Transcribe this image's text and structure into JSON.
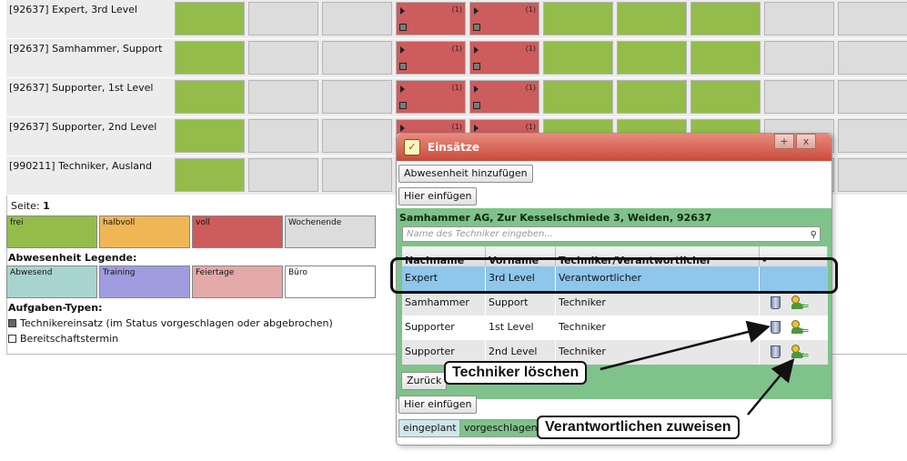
{
  "grid": {
    "rows": [
      {
        "name": "[92637] Expert, 3rd Level",
        "cells": [
          "green",
          "gray",
          "gray",
          "red",
          "red",
          "green",
          "green",
          "green",
          "gray",
          "gray"
        ]
      },
      {
        "name": "[92637] Samhammer, Support",
        "cells": [
          "green",
          "gray",
          "gray",
          "red",
          "red",
          "green",
          "green",
          "green",
          "gray",
          "gray"
        ]
      },
      {
        "name": "[92637] Supporter, 1st Level",
        "cells": [
          "green",
          "gray",
          "gray",
          "red",
          "red",
          "green",
          "green",
          "green",
          "gray",
          "gray"
        ]
      },
      {
        "name": "[92637] Supporter, 2nd Level",
        "cells": [
          "green",
          "gray",
          "gray",
          "red",
          "red",
          "green",
          "green",
          "green",
          "gray",
          "gray"
        ]
      },
      {
        "name": "[990211] Techniker, Ausland",
        "cells": [
          "green",
          "gray",
          "gray",
          "red",
          "red",
          "green",
          "green",
          "green",
          "gray",
          "gray"
        ]
      }
    ],
    "red_cell_count": "(1)"
  },
  "pager": {
    "label": "Seite:",
    "page": "1"
  },
  "status_legend": [
    {
      "label": "frei",
      "color": "#93bc4a"
    },
    {
      "label": "halbvoll",
      "color": "#f0b656"
    },
    {
      "label": "voll",
      "color": "#cd5c5c"
    },
    {
      "label": "Wochenende",
      "color": "#dcdcdc"
    }
  ],
  "absence_legend": {
    "title": "Abwesenheit Legende:",
    "items": [
      {
        "label": "Abwesend",
        "color": "#a8d4d0"
      },
      {
        "label": "Training",
        "color": "#a09ce0"
      },
      {
        "label": "Feiertage",
        "color": "#e3a9a9"
      },
      {
        "label": "Büro",
        "color": "#ffffff"
      }
    ]
  },
  "task_types": {
    "title": "Aufgaben-Typen:",
    "items": [
      {
        "label": "Technikereinsatz (im Status vorgeschlagen oder abgebrochen)",
        "filled": true
      },
      {
        "label": "Bereitschaftstermin",
        "filled": false
      }
    ]
  },
  "dialog": {
    "title": "Einsätze",
    "maximize": "+",
    "close": "x",
    "add_absence": "Abwesenheit hinzufügen",
    "insert_top": "Hier einfügen",
    "address": "Samhammer AG, Zur Kesselschmiede 3, Weiden, 92637",
    "search_placeholder": "Name des Techniker eingeben...",
    "columns": [
      "Nachname",
      "Vorname",
      "Techniker/Verantwortlicher",
      "-"
    ],
    "rows": [
      {
        "last": "Expert",
        "first": "3rd Level",
        "role": "Verantwortlicher",
        "selected": true,
        "actions": false
      },
      {
        "last": "Samhammer",
        "first": "Support",
        "role": "Techniker",
        "selected": false,
        "actions": true
      },
      {
        "last": "Supporter",
        "first": "1st Level",
        "role": "Techniker",
        "selected": false,
        "actions": true
      },
      {
        "last": "Supporter",
        "first": "2nd Level",
        "role": "Techniker",
        "selected": false,
        "actions": true
      }
    ],
    "back": "Zurück",
    "insert_bottom": "Hier einfügen",
    "status_tabs": [
      {
        "label": "eingeplant",
        "color": "#cfe7ec"
      },
      {
        "label": "vorgeschlagen",
        "color": "#7fc28a"
      }
    ]
  },
  "annotations": {
    "delete_tech": "Techniker löschen",
    "assign_responsible": "Verantwortlichen zuweisen"
  }
}
